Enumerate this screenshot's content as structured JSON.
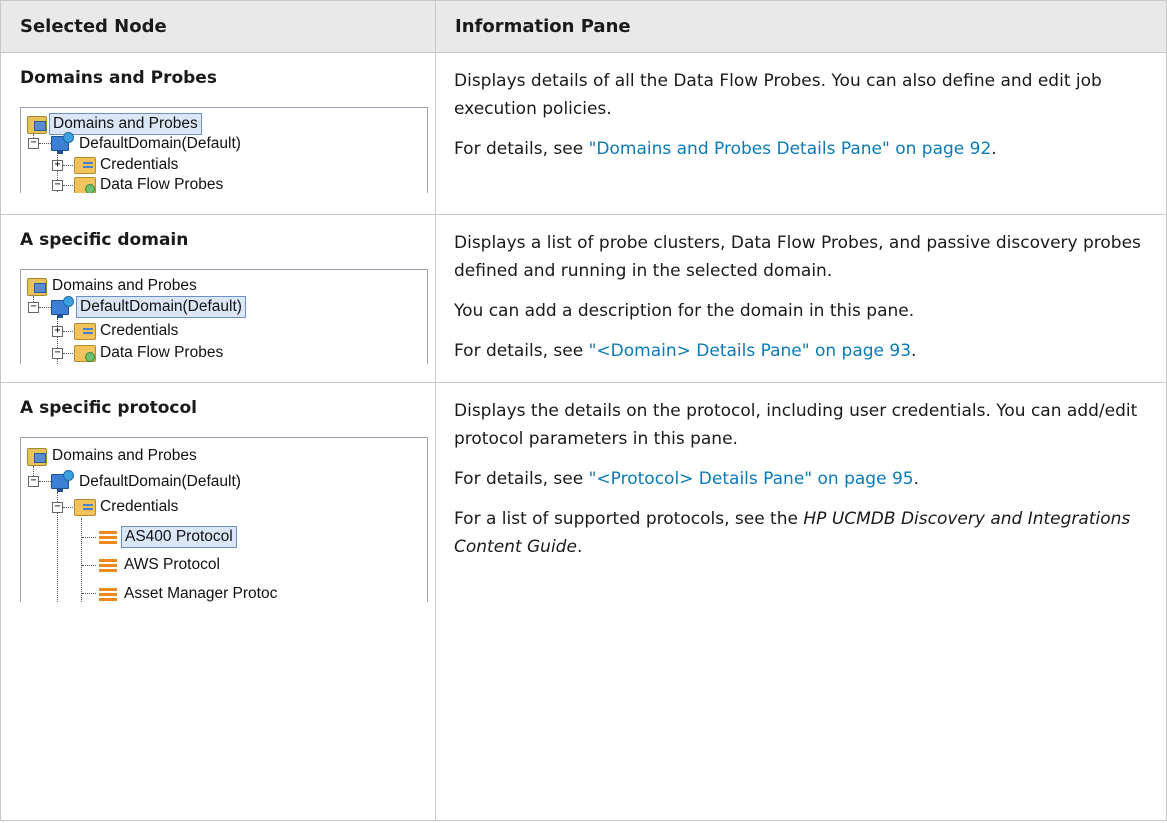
{
  "headers": {
    "col1": "Selected Node",
    "col2": "Information Pane"
  },
  "rows": [
    {
      "title": "Domains and Probes",
      "tree": {
        "root": "Domains and Probes",
        "domain": "DefaultDomain(Default)",
        "credentials": "Credentials",
        "probes": "Data Flow Probes"
      },
      "para1": "Displays details of all the Data Flow Probes. You can also define and edit job execution policies.",
      "para2_prefix": "For details, see ",
      "para2_link": "\"Domains and Probes Details Pane\" on page 92",
      "para2_suffix": "."
    },
    {
      "title": "A specific domain",
      "tree": {
        "root": "Domains and Probes",
        "domain": "DefaultDomain(Default)",
        "credentials": "Credentials",
        "probes": "Data Flow Probes"
      },
      "para1": "Displays a list of probe clusters, Data Flow Probes, and passive discovery probes defined and running in the selected domain.",
      "para2": "You can add a description for the domain in this pane.",
      "para3_prefix": "For details, see ",
      "para3_link": "\"<Domain> Details Pane\" on page 93",
      "para3_suffix": "."
    },
    {
      "title": "A specific protocol",
      "tree": {
        "root": "Domains and Probes",
        "domain": "DefaultDomain(Default)",
        "credentials": "Credentials",
        "proto1": "AS400 Protocol",
        "proto2": "AWS Protocol",
        "proto3": "Asset Manager Protoc"
      },
      "para1": "Displays the details on the protocol, including user credentials. You can add/edit protocol parameters in this pane.",
      "para2_prefix": "For details, see ",
      "para2_link": "\"<Protocol> Details Pane\" on page 95",
      "para2_suffix": ".",
      "para3_prefix": "For a list of supported protocols, see the ",
      "para3_italic": "HP UCMDB Discovery and Integrations Content Guide",
      "para3_suffix": "."
    }
  ]
}
